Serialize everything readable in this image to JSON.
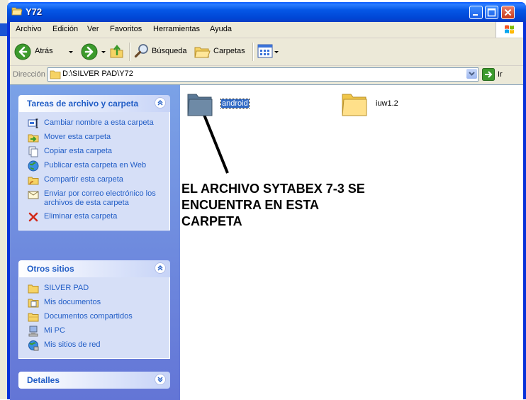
{
  "window": {
    "title": "Y72"
  },
  "menu": [
    "Archivo",
    "Edición",
    "Ver",
    "Favoritos",
    "Herramientas",
    "Ayuda"
  ],
  "toolbar": {
    "back": "Atrás",
    "search": "Búsqueda",
    "folders": "Carpetas"
  },
  "address": {
    "label": "Dirección",
    "path": "D:\\SILVER PAD\\Y72",
    "go": "Ir"
  },
  "tasks_panel": {
    "title": "Tareas de archivo y carpeta",
    "items": [
      {
        "label": "Cambiar nombre a esta carpeta",
        "icon": "rename-icon"
      },
      {
        "label": "Mover esta carpeta",
        "icon": "move-folder-icon"
      },
      {
        "label": "Copiar esta carpeta",
        "icon": "copy-icon"
      },
      {
        "label": "Publicar esta carpeta en Web",
        "icon": "globe-icon"
      },
      {
        "label": "Compartir esta carpeta",
        "icon": "share-folder-icon"
      },
      {
        "label": "Enviar por correo electrónico los archivos de esta carpeta",
        "icon": "email-icon"
      },
      {
        "label": "Eliminar esta carpeta",
        "icon": "delete-icon"
      }
    ]
  },
  "places_panel": {
    "title": "Otros sitios",
    "items": [
      {
        "label": "SILVER PAD",
        "icon": "folder-icon"
      },
      {
        "label": "Mis documentos",
        "icon": "documents-icon"
      },
      {
        "label": "Documentos compartidos",
        "icon": "shared-folder-icon"
      },
      {
        "label": "Mi PC",
        "icon": "computer-icon"
      },
      {
        "label": "Mis sitios de red",
        "icon": "network-icon"
      }
    ]
  },
  "details_panel": {
    "title": "Detalles"
  },
  "files": [
    {
      "name": "android",
      "selected": true
    },
    {
      "name": "iuw1.2",
      "selected": false
    }
  ],
  "annotation": "EL ARCHIVO SYTABEX 7-3 SE\nENCUENTRA EN ESTA\nCARPETA",
  "colors": {
    "titlebar": "#0058e6",
    "taskpane": "#6f8ee0",
    "link": "#215dc6",
    "selection": "#316ac5"
  }
}
